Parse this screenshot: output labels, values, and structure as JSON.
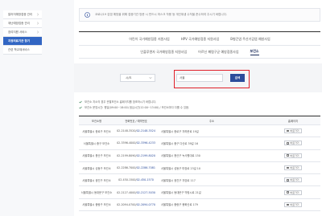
{
  "sidebar": {
    "items": [
      {
        "label": "알러지예방접종 관리",
        "active": false
      },
      {
        "label": "재난예방접종 관리",
        "active": false
      },
      {
        "label": "참여지원 서비스",
        "active": false
      },
      {
        "label": "지정의료기관 찾기",
        "active": true
      },
      {
        "label": "관련 학교재서비스",
        "active": false
      }
    ]
  },
  "notice": {
    "text": "코로나19 감염 예방을 위해 접종기관 방문 시 반드시 마스크 착용 등 개인위생 수칙을 준수하여 주시기 바랍니다."
  },
  "tabs": {
    "row1": [
      "어린이 국가예방접종 지원사업",
      "HPV 국가예방접종 지원사업",
      "B형간염 주산기감염 예방사업"
    ],
    "row2": [
      "인플루엔자 국가예방접종 지원사업",
      "어르신 폐렴구균 예방접종사업",
      "보건소"
    ],
    "active_label": "보건소"
  },
  "search": {
    "select_value": "시/도",
    "input_value": "서울",
    "button_label": "검색"
  },
  "notes": {
    "line1": "보건소 지소의 경우 관할보건소 홈페이지를 참조하시기 바랍니다.",
    "line2": "보건소 운영시간: 평일(09:00~18:00) 점심시간(12:00~13:00) / 보건소마다 다를 수 있음."
  },
  "table": {
    "headers": [
      "보건소명",
      "전화번호 / 예약번호",
      "주소",
      "홈페이지"
    ],
    "view_label": "바로가기",
    "rows": [
      {
        "name": "서울특별시 종로구 보건소",
        "tel": "02-2148-3520",
        "tel2": "02-2148-3524",
        "addr": "서울특별시 종로구 자하문로 19길"
      },
      {
        "name": "서울특별시 중구 보건소",
        "tel": "02-3396-4000",
        "tel2": "02-3396-4233",
        "addr": "서울특별시 중구 다산로 39길 16"
      },
      {
        "name": "서울특별시 용산구 보건소",
        "tel": "02-2199-8090",
        "tel2": "02-2199-8020",
        "addr": "서울특별시 용산구 녹사평대로 150"
      },
      {
        "name": "서울특별시 성동구 보건소",
        "tel": "02-2286-7000",
        "tel2": "02-2286-7081",
        "addr": "서울특별시 성동구 마장로 23길 10"
      },
      {
        "name": "서울특별시 광진구 보건소",
        "tel": "02-450-1500",
        "tel2": "02-450-1570",
        "addr": "서울특별시 광진구 자양로 117"
      },
      {
        "name": "서울특별시 동대문구 보건소",
        "tel": "02-2127-4000",
        "tel2": "02-2127-5030",
        "addr": "서울특별시 동대문구 약령시로 21길"
      },
      {
        "name": "서울특별시 중랑구 보건소",
        "tel": "02-2094-0700",
        "tel2": "02-2094-0770",
        "addr": "서울특별시 중랑구 봉화산로 179"
      }
    ]
  }
}
